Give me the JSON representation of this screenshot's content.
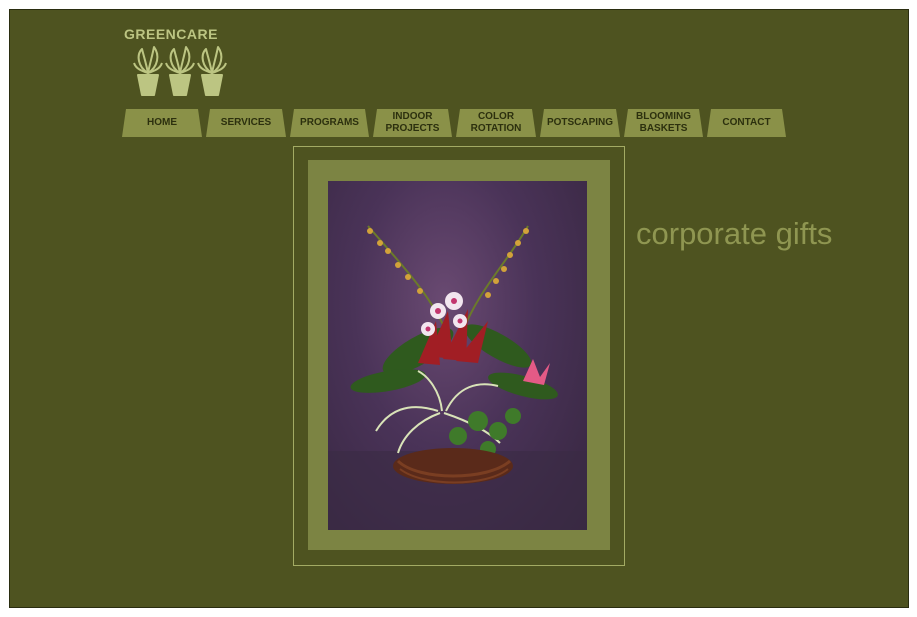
{
  "brand": {
    "name": "GREENCARE"
  },
  "nav": {
    "items": [
      {
        "label": "HOME"
      },
      {
        "label": "SERVICES"
      },
      {
        "label": "PROGRAMS"
      },
      {
        "label": "INDOOR PROJECTS"
      },
      {
        "label": "COLOR ROTATION"
      },
      {
        "label": "POTSCAPING"
      },
      {
        "label": "BLOOMING BASKETS"
      },
      {
        "label": "CONTACT"
      }
    ]
  },
  "main": {
    "heading": "corporate gifts"
  },
  "colors": {
    "page_background": "#4e5320",
    "tab_background": "#8a9148",
    "tab_text": "#2c300e",
    "logo": "#bcc582",
    "heading": "#8f9651",
    "frame_mat": "#7c8443"
  },
  "icons": [
    "potted-plant-icon",
    "potted-plant-icon",
    "potted-plant-icon"
  ]
}
